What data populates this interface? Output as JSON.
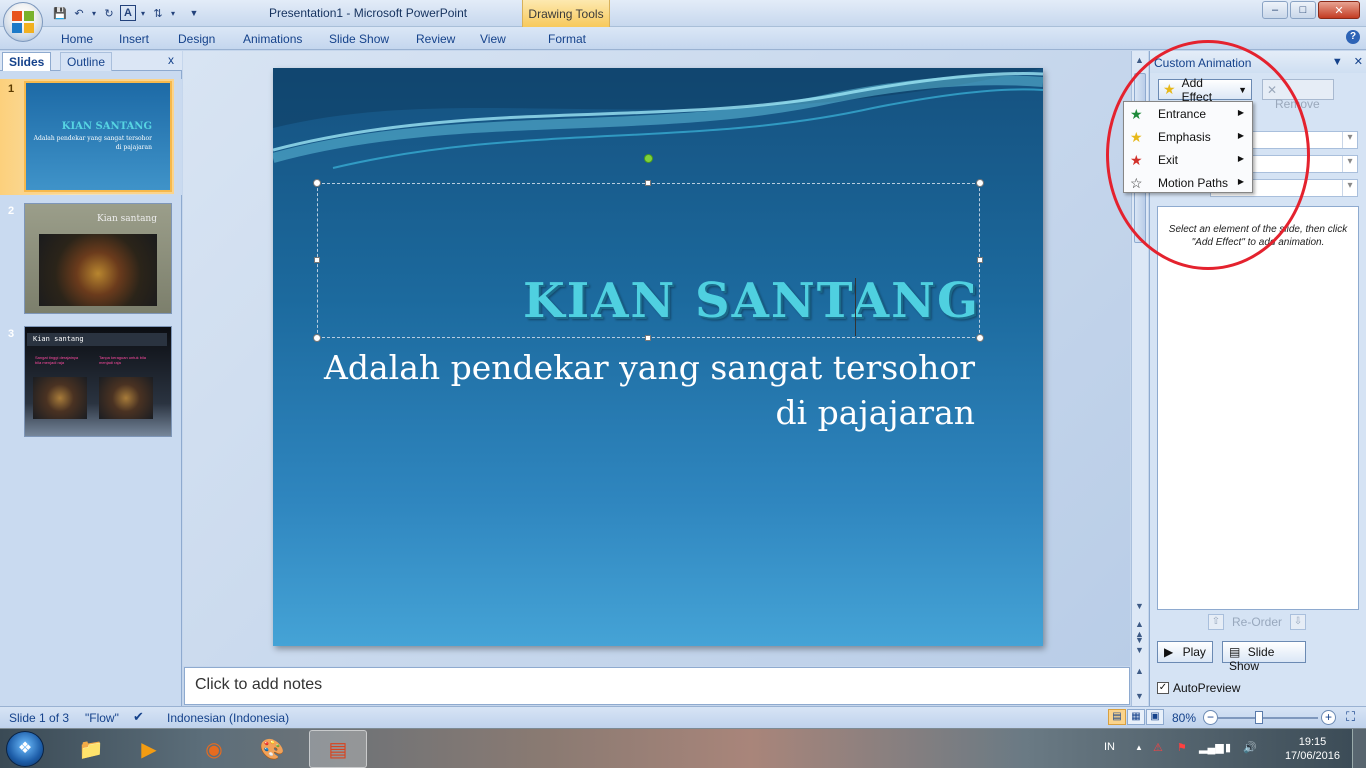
{
  "window": {
    "title": "Presentation1 - Microsoft PowerPoint",
    "context_tab_group": "Drawing Tools",
    "controls": {
      "minimize": "–",
      "maximize": "□",
      "close": "✕"
    }
  },
  "ribbon": {
    "tabs": [
      "Home",
      "Insert",
      "Design",
      "Animations",
      "Slide Show",
      "Review",
      "View",
      "Format"
    ],
    "help": "?"
  },
  "left_panel": {
    "tabs": {
      "slides": "Slides",
      "outline": "Outline"
    },
    "close": "x",
    "thumbnails": [
      {
        "number": "1",
        "title": "KIAN SANTANG",
        "subtitle": "Adalah pendekar yang sangat tersohor di pajajaran"
      },
      {
        "number": "2",
        "title": "Kian santang"
      },
      {
        "number": "3",
        "title": "Kian santang",
        "col1": "Sangat tinggi derajatnya bila menjadi raja",
        "col2": "Tanpa keraguan untuk bila menjadi raja"
      }
    ]
  },
  "slide": {
    "title": "KIAN SANTANG",
    "subtitle_line1": "Adalah pendekar yang sangat tersohor",
    "subtitle_line2": "di pajajaran"
  },
  "notes": {
    "placeholder": "Click to add notes"
  },
  "animation_pane": {
    "header": "Custom Animation",
    "add_effect": "Add Effect",
    "remove": "Remove",
    "hint": "Select an element of the slide, then click \"Add Effect\" to add animation.",
    "reorder": "Re-Order",
    "play": "Play",
    "slide_show": "Slide Show",
    "autopreview": "AutoPreview",
    "autopreview_checked": true
  },
  "effect_menu": {
    "items": [
      {
        "label": "Entrance",
        "icon": "entrance-star-icon",
        "color": "#1e8a3a"
      },
      {
        "label": "Emphasis",
        "icon": "emphasis-star-icon",
        "color": "#e7b81a"
      },
      {
        "label": "Exit",
        "icon": "exit-star-icon",
        "color": "#d2312b"
      },
      {
        "label": "Motion Paths",
        "icon": "motion-path-star-icon",
        "color": "#ffffff"
      }
    ]
  },
  "status_bar": {
    "slide_info": "Slide 1 of 3",
    "theme": "\"Flow\"",
    "language": "Indonesian (Indonesia)",
    "zoom": "80%"
  },
  "taskbar": {
    "language": "IN",
    "time": "19:15",
    "date": "17/06/2016"
  },
  "colors": {
    "title_text": "#4fd0e0",
    "annotation_circle": "#e4222e",
    "selected_thumb_border": "#f6b94d"
  }
}
